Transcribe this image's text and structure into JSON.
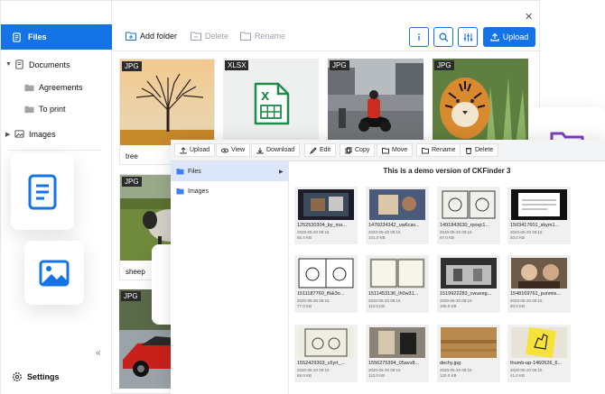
{
  "sidebar": {
    "files_label": "Files",
    "tree": [
      {
        "label": "Documents"
      },
      {
        "label": "Agreements"
      },
      {
        "label": "To print"
      },
      {
        "label": "Images"
      }
    ],
    "collapse_icon": "double-chevron-left-icon",
    "settings_label": "Settings"
  },
  "toolbar": {
    "add_folder": "Add folder",
    "delete": "Delete",
    "rename": "Rename",
    "upload": "Upload"
  },
  "tiles": [
    {
      "type": "JPG",
      "caption": "tree"
    },
    {
      "type": "XLSX",
      "caption": ""
    },
    {
      "type": "JPG",
      "caption": ""
    },
    {
      "type": "JPG",
      "caption": ""
    },
    {
      "type": "JPG",
      "caption": "sheep"
    },
    {
      "type": "JPG",
      "caption": ""
    }
  ],
  "inner": {
    "toolbar": [
      "Upload",
      "View",
      "Download",
      "Edit",
      "Copy",
      "Move",
      "Rename",
      "Delete"
    ],
    "folders": [
      "Files",
      "Images"
    ],
    "title": "This is a demo version of CKFinder 3",
    "files": [
      {
        "name": "1252530304_by_ma...",
        "date": "2020-05-20 09:15",
        "size": "55.4 KB"
      },
      {
        "name": "1476034342_uw6cav...",
        "date": "2020-05-20 09:15",
        "size": "101.0 KB"
      },
      {
        "name": "1491843630_rpoqc1...",
        "date": "2020-05-20 09:15",
        "size": "97.0 KB"
      },
      {
        "name": "1503417601_skym1...",
        "date": "2020-05-20 09:15",
        "size": "50.0 KB"
      },
      {
        "name": "1511187760_ffak3o...",
        "date": "2020-05-20 09:15",
        "size": "77.0 KB"
      },
      {
        "name": "1511453136_ih0w31...",
        "date": "2020-05-20 09:15",
        "size": "110.0 KB"
      },
      {
        "name": "1519922283_cwueeg...",
        "date": "2020-05-20 09:15",
        "size": "105.0 KB"
      },
      {
        "name": "1548169761_punmix...",
        "date": "2020-05-20 09:15",
        "size": "80.0 KB"
      },
      {
        "name": "1552429303_c6yrt_...",
        "date": "2020-05-20 09:15",
        "size": "68.0 KB"
      },
      {
        "name": "1556275394_05avv8...",
        "date": "2020-05-20 09:15",
        "size": "110.0 KB"
      },
      {
        "name": "dechy.jpg",
        "date": "2020-05-20 09:15",
        "size": "120.0 KB"
      },
      {
        "name": "thumb-up-1460526_6...",
        "date": "2020-05-20 09:15",
        "size": "41.0 KB"
      }
    ]
  },
  "colors": {
    "accent": "#1473e6",
    "purple": "#7b3fc4"
  }
}
